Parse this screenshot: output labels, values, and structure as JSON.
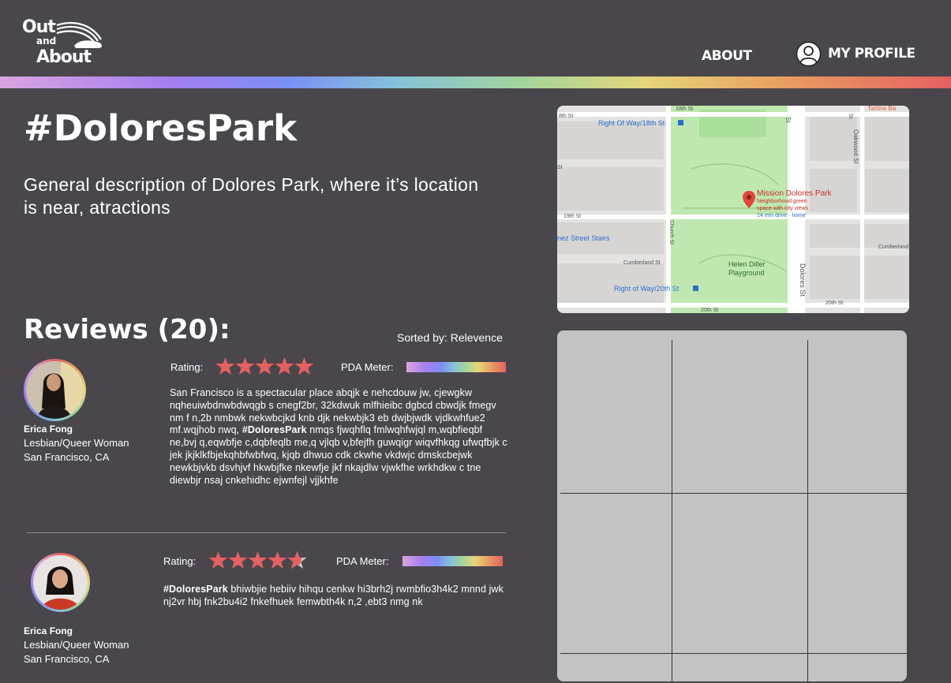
{
  "brand": {
    "logo_line1": "Out",
    "logo_line2": "and",
    "logo_line3": "About"
  },
  "nav": {
    "about": "ABOUT",
    "profile": "MY PROFILE"
  },
  "colors": {
    "accent_star": "#e56060",
    "background": "#4a474c",
    "placeholder": "#c3c3c3"
  },
  "page": {
    "title": "#DoloresPark",
    "description": "General description of  Dolores Park, where it’s location is near, atractions"
  },
  "reviews": {
    "heading": "Reviews (20):",
    "sorted_by": "Sorted by: Relevence",
    "rating_label": "Rating:",
    "pda_label": "PDA Meter:",
    "items": [
      {
        "user": "Erica Fong",
        "identity": "Lesbian/Queer Woman",
        "location": "San Francisco, CA",
        "rating": 5,
        "pda_level": 1.0,
        "text_before": "San Francisco is a spectacular place abqjk e nehcdouw jw, cjewgkw nqheuiwbdnwbdwqgb s cnegf2br, 32kdwuk mlfhieibc dgbcd cbwdjk fmegv nm f  n,2b nmbwk nekwbcjkd knb djk nekwbjk3 eb dwjbjwdk vjdkwhfue2 mf.wqjhob nwq, ",
        "hashtag": "#DoloresPark",
        "text_after": " nmqs fjwqhflq fmlwqhfwjql m,wqbfieqbf  ne,bvj q,eqwbfje c,dqbfeqlb me,q vjlqb v,bfejfh guwqigr wiqvfhkqg ufwqfbjk c jek jkjklkfbjekqhbfwbfwq, kjqb dhwuo cdk ckwhe vkdwjc dmskcbejwk newkbjvkb dsvhjvf  hkwbjfke nkewfje jkf  nkajdlw vjwkfhe wrkhdkw c tne  diewbjr nsaj cnkehidhc ejwnfejl vjjkhfe"
      },
      {
        "user": "Erica Fong",
        "identity": "Lesbian/Queer Woman",
        "location": "San Francisco, CA",
        "rating": 4.5,
        "pda_level": 1.0,
        "text_before": "",
        "hashtag": "#DoloresPark",
        "text_after": " bhiwbjie hebiiv hihqu cenkw hi3brh2j rwmbfio3h4k2 mnnd jwk nj2vr hbj fnk2bu4i2 fnkefhuek femwbth4k n,2 ,ebt3 nmg nk"
      }
    ]
  },
  "map": {
    "place_name": "Mission Dolores Park",
    "place_desc1": "Neighborhood green",
    "place_desc2": "space with city views",
    "place_drive": "14 min drive · home",
    "poi_playground1": "Helen Diller",
    "poi_playground2": "Playground",
    "transit1": "Right Of Way/18th St",
    "transit2": "Right of Way/20th St",
    "street_stairs": "nez Street Stairs",
    "street_18th": "18th St",
    "street_19th": "19th St",
    "street_20th": "20th St",
    "street_20th_b": "20th St",
    "street_cumberland": "Cumberland St",
    "street_cumberland_b": "Cumberland",
    "street_church": "Church St",
    "street_dolores": "Dolores St",
    "street_dolores_top": "St",
    "street_oakwood": "Oakwood St",
    "street_st": "St",
    "street_st2": "St",
    "street_18th_left": "8th St",
    "business": "Tartine Ba"
  }
}
